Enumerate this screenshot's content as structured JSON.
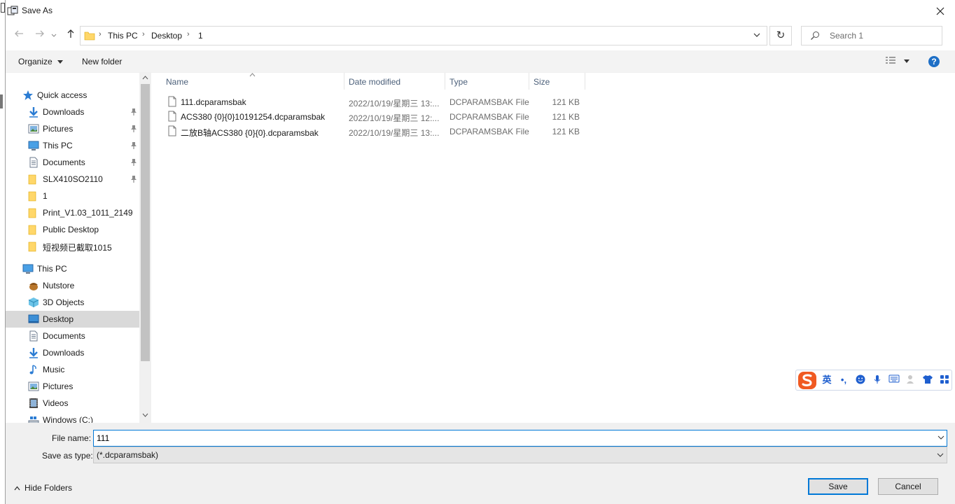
{
  "window": {
    "title": "Save As"
  },
  "address": {
    "breadcrumbs": [
      "This PC",
      "Desktop",
      "1"
    ]
  },
  "search": {
    "placeholder": "Search 1"
  },
  "toolbar": {
    "organize": "Organize",
    "new_folder": "New folder"
  },
  "nav": {
    "items": [
      {
        "label": "Quick access",
        "icon": "star-icon",
        "pinned": false
      },
      {
        "label": "Downloads",
        "icon": "download-icon",
        "pinned": true
      },
      {
        "label": "Pictures",
        "icon": "pictures-icon",
        "pinned": true
      },
      {
        "label": "This PC",
        "icon": "monitor-icon",
        "pinned": true
      },
      {
        "label": "Documents",
        "icon": "document-icon",
        "pinned": true
      },
      {
        "label": "SLX410SO2110",
        "icon": "folder-icon",
        "pinned": true
      },
      {
        "label": "1",
        "icon": "folder-icon",
        "pinned": false
      },
      {
        "label": "Print_V1.03_1011_2149",
        "icon": "folder-icon",
        "pinned": false
      },
      {
        "label": "Public Desktop",
        "icon": "folder-icon",
        "pinned": false
      },
      {
        "label": "短视频已截取1015",
        "icon": "folder-icon",
        "pinned": false
      },
      {
        "label": "This PC",
        "icon": "monitor-icon",
        "pinned": false
      },
      {
        "label": "Nutstore",
        "icon": "nutstore-icon",
        "pinned": false
      },
      {
        "label": "3D Objects",
        "icon": "cube-icon",
        "pinned": false
      },
      {
        "label": "Desktop",
        "icon": "desktop-icon",
        "pinned": false,
        "selected": true
      },
      {
        "label": "Documents",
        "icon": "document-icon",
        "pinned": false
      },
      {
        "label": "Downloads",
        "icon": "download-icon",
        "pinned": false
      },
      {
        "label": "Music",
        "icon": "music-icon",
        "pinned": false
      },
      {
        "label": "Pictures",
        "icon": "pictures-icon",
        "pinned": false
      },
      {
        "label": "Videos",
        "icon": "video-icon",
        "pinned": false
      },
      {
        "label": "Windows (C:)",
        "icon": "drive-icon",
        "pinned": false
      }
    ]
  },
  "columns": {
    "name": "Name",
    "date": "Date modified",
    "type": "Type",
    "size": "Size"
  },
  "files": [
    {
      "name": "111.dcparamsbak",
      "date": "2022/10/19/星期三 13:...",
      "type": "DCPARAMSBAK File",
      "size": "121 KB"
    },
    {
      "name": "ACS380 {0}{0}10191254.dcparamsbak",
      "date": "2022/10/19/星期三 12:...",
      "type": "DCPARAMSBAK File",
      "size": "121 KB"
    },
    {
      "name": "二放B轴ACS380 {0}{0}.dcparamsbak",
      "date": "2022/10/19/星期三 13:...",
      "type": "DCPARAMSBAK File",
      "size": "121 KB"
    }
  ],
  "ime": {
    "lang": "英",
    "punct": "•,"
  },
  "form": {
    "file_name_label": "File name:",
    "file_name_value": "111",
    "save_type_label": "Save as type:",
    "save_type_value": "(*.dcparamsbak)"
  },
  "footer": {
    "hide_folders": "Hide Folders",
    "save": "Save",
    "cancel": "Cancel"
  },
  "colors": {
    "accent": "#0078d7",
    "folder": "#ffd76a",
    "selected_bg": "#d9d9d9"
  }
}
